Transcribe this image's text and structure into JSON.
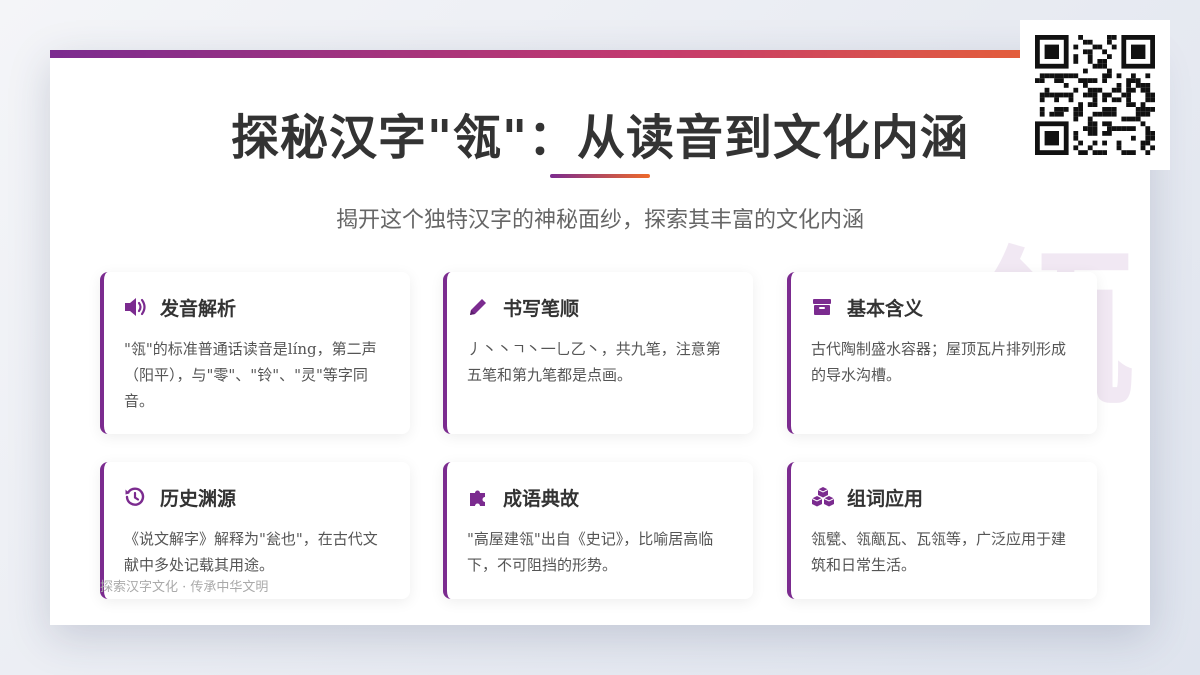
{
  "header": {
    "title": "探秘汉字\"瓴\"：从读音到文化内涵",
    "subtitle": "揭开这个独特汉字的神秘面纱，探索其丰富的文化内涵"
  },
  "watermark_char": "瓴",
  "accent_color": "#7b2b8f",
  "gradient_colors": [
    "#7b2b8f",
    "#c43a6e",
    "#ee6a2a"
  ],
  "cards": [
    {
      "icon": "volume-icon",
      "title": "发音解析",
      "text": "\"瓴\"的标准普通话读音是líng，第二声（阳平），与\"零\"、\"铃\"、\"灵\"等字同音。"
    },
    {
      "icon": "pencil-icon",
      "title": "书写笔顺",
      "text": "丿丶丶ㄱ丶一乚乙丶，共九笔，注意第五笔和第九笔都是点画。"
    },
    {
      "icon": "archive-box-icon",
      "title": "基本含义",
      "text": "古代陶制盛水容器；屋顶瓦片排列形成的导水沟槽。"
    },
    {
      "icon": "history-icon",
      "title": "历史渊源",
      "text": "《说文解字》解释为\"瓮也\"，在古代文献中多处记载其用途。"
    },
    {
      "icon": "puzzle-icon",
      "title": "成语典故",
      "text": "\"高屋建瓴\"出自《史记》，比喻居高临下，不可阻挡的形势。"
    },
    {
      "icon": "cubes-icon",
      "title": "组词应用",
      "text": "瓴甓、瓴甋瓦、瓦瓴等，广泛应用于建筑和日常生活。"
    }
  ],
  "footer": "探索汉字文化 · 传承中华文明"
}
